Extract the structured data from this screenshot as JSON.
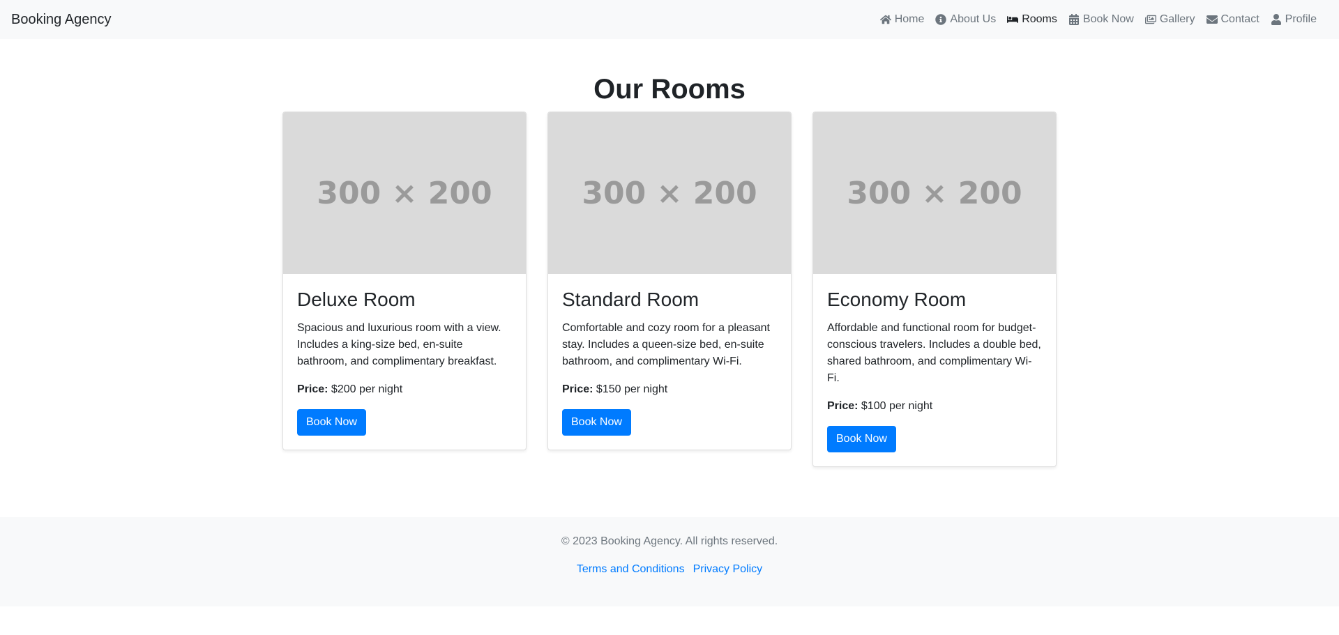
{
  "navbar": {
    "brand": "Booking Agency",
    "items": [
      {
        "label": "Home",
        "icon": "home-icon",
        "active": false
      },
      {
        "label": "About Us",
        "icon": "info-icon",
        "active": false
      },
      {
        "label": "Rooms",
        "icon": "bed-icon",
        "active": true
      },
      {
        "label": "Book Now",
        "icon": "calendar-icon",
        "active": false
      },
      {
        "label": "Gallery",
        "icon": "images-icon",
        "active": false
      },
      {
        "label": "Contact",
        "icon": "envelope-icon",
        "active": false
      },
      {
        "label": "Profile",
        "icon": "user-icon",
        "active": false
      }
    ]
  },
  "main": {
    "title": "Our Rooms",
    "rooms": [
      {
        "image_placeholder": "300 × 200",
        "title": "Deluxe Room",
        "description": "Spacious and luxurious room with a view. Includes a king-size bed, en-suite bathroom, and complimentary breakfast.",
        "price_label": "Price:",
        "price_value": "$200 per night",
        "button": "Book Now"
      },
      {
        "image_placeholder": "300 × 200",
        "title": "Standard Room",
        "description": "Comfortable and cozy room for a pleasant stay. Includes a queen-size bed, en-suite bathroom, and complimentary Wi-Fi.",
        "price_label": "Price:",
        "price_value": "$150 per night",
        "button": "Book Now"
      },
      {
        "image_placeholder": "300 × 200",
        "title": "Economy Room",
        "description": "Affordable and functional room for budget-conscious travelers. Includes a double bed, shared bathroom, and complimentary Wi-Fi.",
        "price_label": "Price:",
        "price_value": "$100 per night",
        "button": "Book Now"
      }
    ]
  },
  "footer": {
    "copyright": "© 2023 Booking Agency. All rights reserved.",
    "links": [
      "Terms and Conditions",
      "Privacy Policy"
    ]
  },
  "colors": {
    "primary": "#007bff",
    "navbar_bg": "#f8f9fa",
    "muted": "#6c757d",
    "placeholder_bg": "#dadada"
  }
}
